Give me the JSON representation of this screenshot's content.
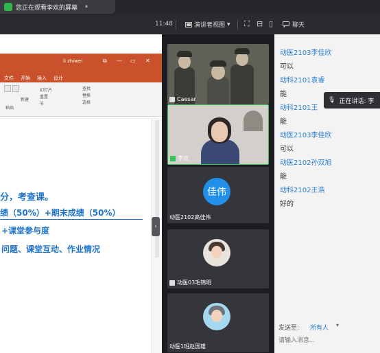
{
  "notice": {
    "text": "您正在观看李欢的屏幕",
    "pause_label": "⏸"
  },
  "toolbar": {
    "time": "11:48",
    "view_label": "演讲者视图",
    "view_arrow": "▾",
    "chat_label": "聊天"
  },
  "slide": {
    "ppt_user": "li zhiwei",
    "tabs": [
      "文件",
      "开始",
      "插入",
      "设计"
    ],
    "ribbon_group": "粘贴",
    "ribbon_items": [
      "新建",
      "幻灯片",
      "重置",
      "节"
    ],
    "ribbon_right": [
      "查找",
      "替换",
      "选择"
    ],
    "line1": "分，考查课。",
    "line2": "绩（50%）+期末成绩（50%）",
    "line3": "+课堂参与度",
    "line4": "问题、课堂互动、作业情况"
  },
  "collapse_label": "›",
  "participants": [
    {
      "name": "Caesar",
      "mic": "muted"
    },
    {
      "name": "李欢",
      "mic": "active"
    },
    {
      "name": "动医2102高佳伟",
      "avatar_text": "佳伟",
      "mic": "muted"
    },
    {
      "name": "动医03毛锦明",
      "mic": "muted"
    },
    {
      "name": "动医1班赵国雄",
      "mic": "muted"
    }
  ],
  "chat": {
    "messages": [
      {
        "name": "动医2103李佳欣",
        "body": "可以"
      },
      {
        "name": "动科2101袁睿",
        "body": "能"
      },
      {
        "name": "动科2101王",
        "body": "能"
      },
      {
        "name": "动医2103李佳欣",
        "body": "可以"
      },
      {
        "name": "动医2102孙双旭",
        "body": "能"
      },
      {
        "name": "动科2102王浩",
        "body": "好的"
      }
    ],
    "speaking_label": "正在讲话: 李",
    "send_label": "发送至:",
    "send_to": "所有人",
    "send_arrow": "▾",
    "input_placeholder": "请输入消息..."
  }
}
